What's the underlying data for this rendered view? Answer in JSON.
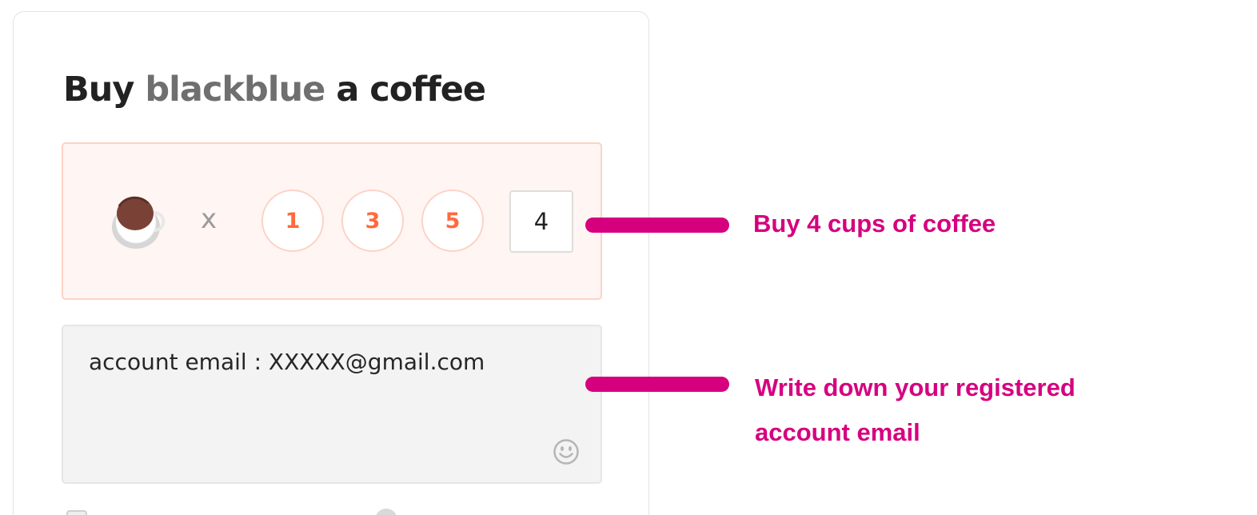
{
  "widget": {
    "title_prefix": "Buy",
    "creator_name": "blackblue",
    "title_suffix": "a coffee",
    "multiplier_symbol": "x",
    "quantity_presets": [
      "1",
      "3",
      "5"
    ],
    "quantity_value": "4",
    "message_value": "account email : XXXXX@gmail.com"
  },
  "annotations": {
    "quantity_note": "Buy 4 cups of coffee",
    "email_note_line1": "Write down your registered",
    "email_note_line2": "account email"
  },
  "icons": {
    "coffee": "coffee-cup-icon",
    "emoji": "smiley-face-icon"
  },
  "colors": {
    "accent": "#ff6a3d",
    "annotation": "#d6007f",
    "cup_box_bg": "#fff5f3",
    "cup_box_border": "#fcd3c5"
  }
}
